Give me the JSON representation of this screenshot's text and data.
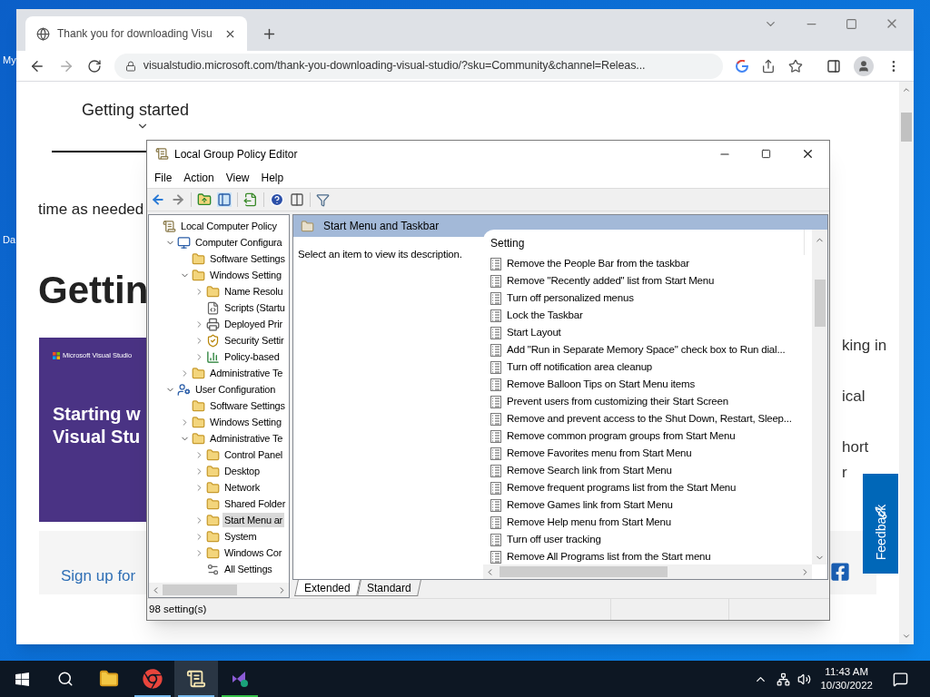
{
  "desktop": {
    "icon_labels": [
      "My",
      "Da"
    ]
  },
  "browser": {
    "tab": {
      "title": "Thank you for downloading Visu"
    },
    "url": "visualstudio.microsoft.com/thank-you-downloading-visual-studio/?sku=Community&channel=Releas...",
    "page": {
      "nav_tab": "Getting started",
      "intro_fragment": "time as needed",
      "heading_fragment": "Gettin",
      "card": {
        "brand": "Microsoft Visual Studio",
        "title_lines": [
          "Starting w",
          "Visual Stu"
        ]
      },
      "signup_fragment": "Sign up for",
      "right_fragments": [
        "king in",
        "ical",
        "hort",
        "r"
      ],
      "feedback_button": "Feedback"
    }
  },
  "gpe": {
    "title": "Local Group Policy Editor",
    "menu": [
      "File",
      "Action",
      "View",
      "Help"
    ],
    "tree": [
      {
        "label": "Local Computer Policy",
        "kind": "policy",
        "selected": false,
        "children": [
          {
            "label": "Computer Configura",
            "kind": "computer",
            "has_children": true,
            "expanded": true,
            "selected": false,
            "children": [
              {
                "label": "Software Settings",
                "kind": "folder",
                "has_children": false,
                "expanded": false,
                "selected": false
              },
              {
                "label": "Windows Setting",
                "kind": "folder",
                "has_children": true,
                "expanded": true,
                "selected": false,
                "children": [
                  {
                    "label": "Name Resolu",
                    "kind": "folder",
                    "has_children": true,
                    "expanded": false,
                    "selected": false
                  },
                  {
                    "label": "Scripts (Startu",
                    "kind": "script",
                    "has_children": false,
                    "expanded": false,
                    "selected": false
                  },
                  {
                    "label": "Deployed Prir",
                    "kind": "printer",
                    "has_children": true,
                    "expanded": false,
                    "selected": false
                  },
                  {
                    "label": "Security Settir",
                    "kind": "security",
                    "has_children": true,
                    "expanded": false,
                    "selected": false
                  },
                  {
                    "label": "Policy-based",
                    "kind": "chart",
                    "has_children": true,
                    "expanded": false,
                    "selected": false
                  }
                ]
              },
              {
                "label": "Administrative Te",
                "kind": "folder",
                "has_children": true,
                "expanded": false,
                "selected": false
              }
            ]
          },
          {
            "label": "User Configuration",
            "kind": "user",
            "has_children": true,
            "expanded": true,
            "selected": false,
            "children": [
              {
                "label": "Software Settings",
                "kind": "folder",
                "has_children": false,
                "expanded": false,
                "selected": false
              },
              {
                "label": "Windows Setting",
                "kind": "folder",
                "has_children": true,
                "expanded": false,
                "selected": false
              },
              {
                "label": "Administrative Te",
                "kind": "folder",
                "has_children": true,
                "expanded": true,
                "selected": false,
                "children": [
                  {
                    "label": "Control Panel",
                    "kind": "folder",
                    "has_children": true,
                    "expanded": false,
                    "selected": false
                  },
                  {
                    "label": "Desktop",
                    "kind": "folder",
                    "has_children": true,
                    "expanded": false,
                    "selected": false
                  },
                  {
                    "label": "Network",
                    "kind": "folder",
                    "has_children": true,
                    "expanded": false,
                    "selected": false
                  },
                  {
                    "label": "Shared Folder",
                    "kind": "folder",
                    "has_children": false,
                    "expanded": false,
                    "selected": false
                  },
                  {
                    "label": "Start Menu ar",
                    "kind": "folder",
                    "has_children": true,
                    "expanded": false,
                    "selected": true
                  },
                  {
                    "label": "System",
                    "kind": "folder",
                    "has_children": true,
                    "expanded": false,
                    "selected": false
                  },
                  {
                    "label": "Windows Cor",
                    "kind": "folder",
                    "has_children": true,
                    "expanded": false,
                    "selected": false
                  },
                  {
                    "label": "All Settings",
                    "kind": "all-settings",
                    "has_children": false,
                    "expanded": false,
                    "selected": false
                  }
                ]
              }
            ]
          }
        ]
      }
    ],
    "pane_title": "Start Menu and Taskbar",
    "description": "Select an item to view its description.",
    "column": "Setting",
    "settings": [
      "Remove the People Bar from the taskbar",
      "Remove \"Recently added\" list from Start Menu",
      "Turn off personalized menus",
      "Lock the Taskbar",
      "Start Layout",
      "Add \"Run in Separate Memory Space\" check box to Run dial...",
      "Turn off notification area cleanup",
      "Remove Balloon Tips on Start Menu items",
      "Prevent users from customizing their Start Screen",
      "Remove and prevent access to the Shut Down, Restart, Sleep...",
      "Remove common program groups from Start Menu",
      "Remove Favorites menu from Start Menu",
      "Remove Search link from Start Menu",
      "Remove frequent programs list from the Start Menu",
      "Remove Games link from Start Menu",
      "Remove Help menu from Start Menu",
      "Turn off user tracking",
      "Remove All Programs list from the Start menu"
    ],
    "view_tabs": [
      {
        "label": "Extended",
        "selected": true
      },
      {
        "label": "Standard",
        "selected": false
      }
    ],
    "status": "98 setting(s)"
  },
  "taskbar": {
    "items": [
      {
        "kind": "start",
        "running": false,
        "selected": false
      },
      {
        "kind": "search",
        "running": false,
        "selected": false
      },
      {
        "kind": "explorer",
        "running": false,
        "selected": false
      },
      {
        "kind": "chrome",
        "running": true,
        "selected": false
      },
      {
        "kind": "policy",
        "running": true,
        "selected": true
      },
      {
        "kind": "studio",
        "running": true,
        "selected": false
      }
    ],
    "time": "11:43 AM",
    "date": "10/30/2022"
  }
}
